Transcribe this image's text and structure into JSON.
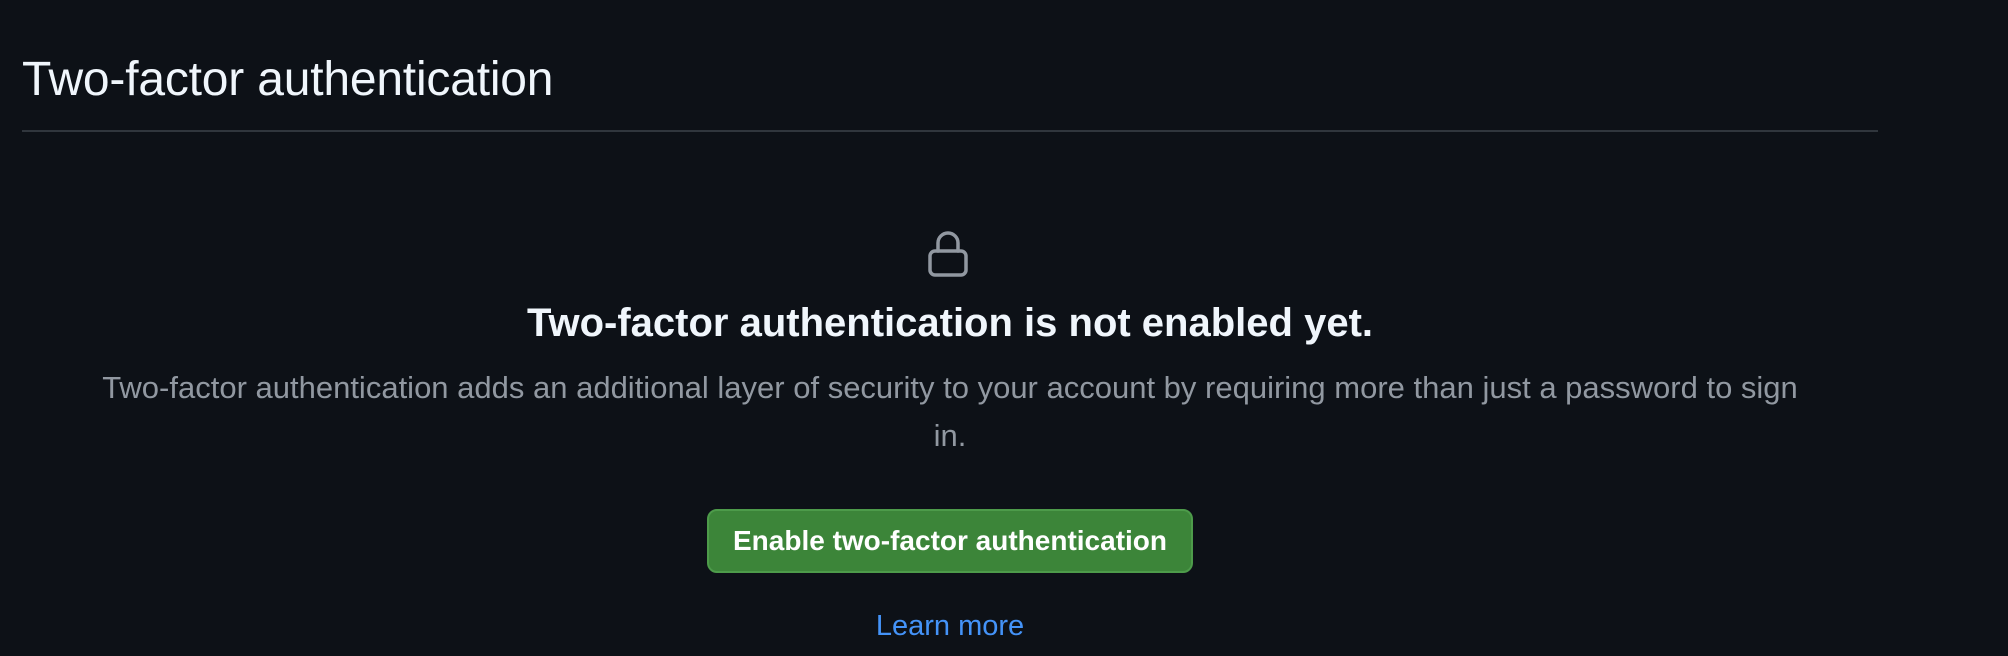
{
  "header": {
    "title": "Two-factor authentication"
  },
  "blankslate": {
    "icon": "lock-icon",
    "heading": "Two-factor authentication is not enabled yet.",
    "description": "Two-factor authentication adds an additional layer of security to your account by requiring more than just a password to sign in.",
    "enable_button_label": "Enable two-factor authentication",
    "learn_more_label": "Learn more"
  },
  "colors": {
    "background": "#0d1117",
    "text_primary": "#f0f6fc",
    "text_muted": "#9198a1",
    "button_green": "#3c8539",
    "link_blue": "#4493f8"
  }
}
